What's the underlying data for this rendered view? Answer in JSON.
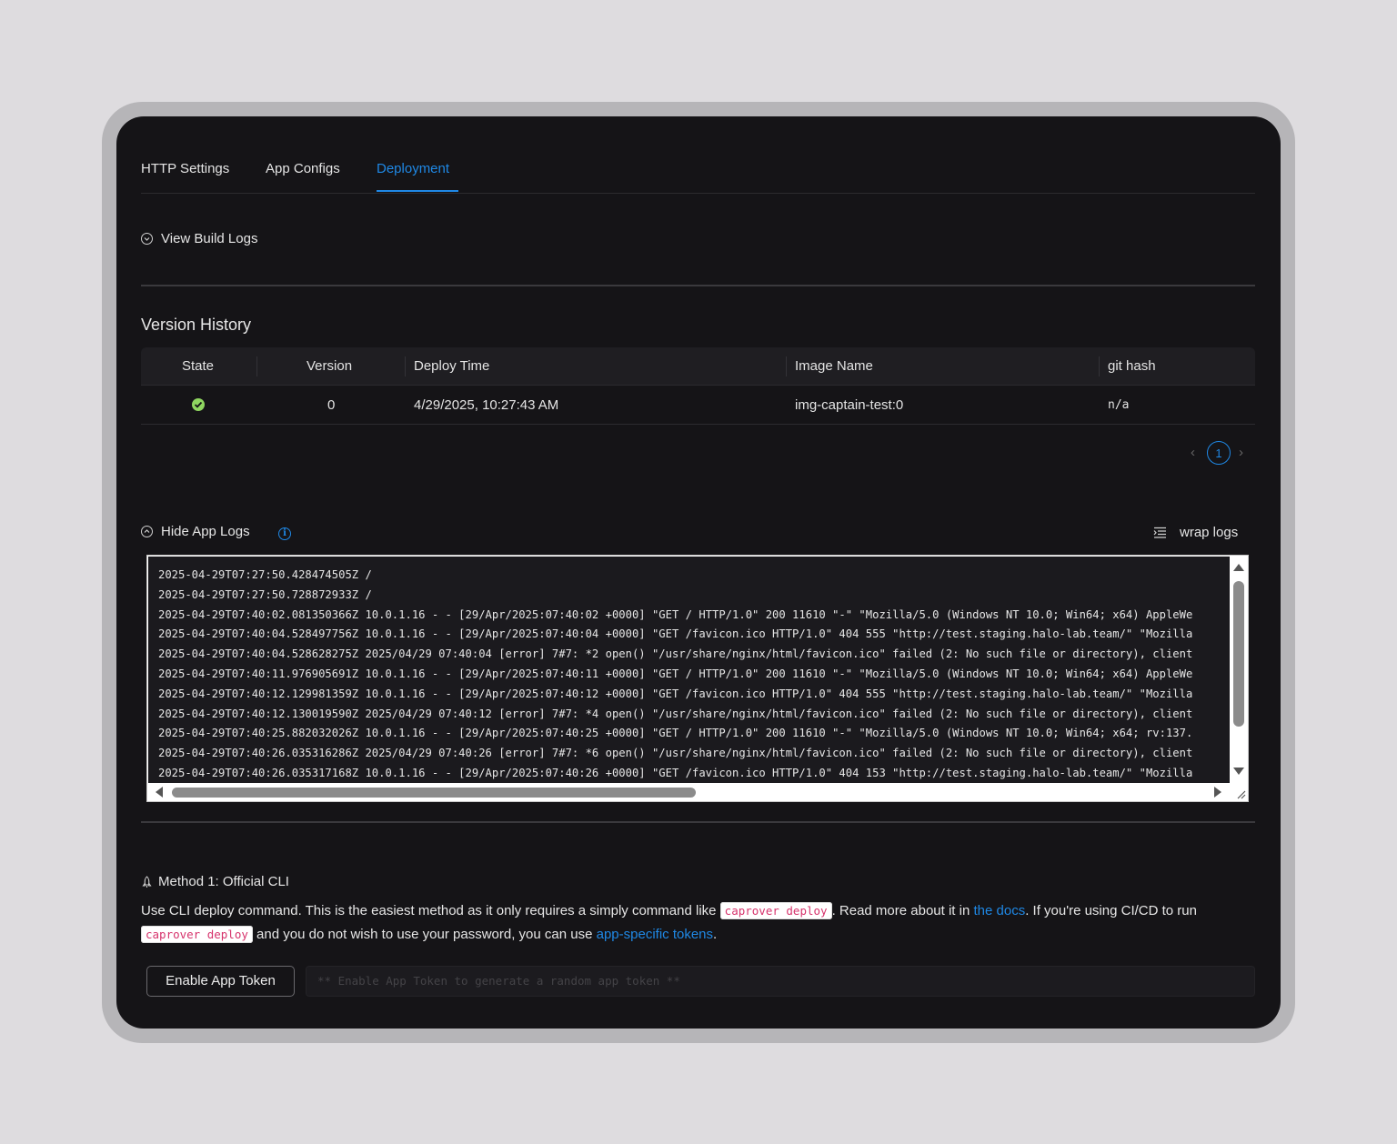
{
  "tabs": [
    {
      "label": "HTTP Settings"
    },
    {
      "label": "App Configs"
    },
    {
      "label": "Deployment"
    }
  ],
  "active_tab": "Deployment",
  "build_logs": {
    "label": "View Build Logs"
  },
  "version_history": {
    "title": "Version History",
    "columns": [
      "State",
      "Version",
      "Deploy Time",
      "Image Name",
      "git hash"
    ],
    "rows": [
      {
        "state": "success",
        "version": "0",
        "deploy_time": "4/29/2025, 10:27:43 AM",
        "image_name": "img-captain-test:0",
        "git_hash": "n/a"
      }
    ],
    "pagination": {
      "current_page": "1",
      "prev": "‹",
      "next": "›"
    }
  },
  "app_logs": {
    "toggle_label": "Hide App Logs",
    "wrap_label": "wrap logs",
    "lines": [
      "2025-04-29T07:27:50.428474505Z /",
      "2025-04-29T07:27:50.728872933Z /",
      "2025-04-29T07:40:02.081350366Z 10.0.1.16 - - [29/Apr/2025:07:40:02 +0000] \"GET / HTTP/1.0\" 200 11610 \"-\" \"Mozilla/5.0 (Windows NT 10.0; Win64; x64) AppleWe",
      "2025-04-29T07:40:04.528497756Z 10.0.1.16 - - [29/Apr/2025:07:40:04 +0000] \"GET /favicon.ico HTTP/1.0\" 404 555 \"http://test.staging.halo-lab.team/\" \"Mozilla",
      "2025-04-29T07:40:04.528628275Z 2025/04/29 07:40:04 [error] 7#7: *2 open() \"/usr/share/nginx/html/favicon.ico\" failed (2: No such file or directory), client",
      "2025-04-29T07:40:11.976905691Z 10.0.1.16 - - [29/Apr/2025:07:40:11 +0000] \"GET / HTTP/1.0\" 200 11610 \"-\" \"Mozilla/5.0 (Windows NT 10.0; Win64; x64) AppleWe",
      "2025-04-29T07:40:12.129981359Z 10.0.1.16 - - [29/Apr/2025:07:40:12 +0000] \"GET /favicon.ico HTTP/1.0\" 404 555 \"http://test.staging.halo-lab.team/\" \"Mozilla",
      "2025-04-29T07:40:12.130019590Z 2025/04/29 07:40:12 [error] 7#7: *4 open() \"/usr/share/nginx/html/favicon.ico\" failed (2: No such file or directory), client",
      "2025-04-29T07:40:25.882032026Z 10.0.1.16 - - [29/Apr/2025:07:40:25 +0000] \"GET / HTTP/1.0\" 200 11610 \"-\" \"Mozilla/5.0 (Windows NT 10.0; Win64; x64; rv:137.",
      "2025-04-29T07:40:26.035316286Z 2025/04/29 07:40:26 [error] 7#7: *6 open() \"/usr/share/nginx/html/favicon.ico\" failed (2: No such file or directory), client",
      "2025-04-29T07:40:26.035317168Z 10.0.1.16 - - [29/Apr/2025:07:40:26 +0000] \"GET /favicon.ico HTTP/1.0\" 404 153 \"http://test.staging.halo-lab.team/\" \"Mozilla"
    ]
  },
  "method": {
    "title": "Method 1: Official CLI",
    "text_1": "Use CLI deploy command. This is the easiest method as it only requires a simply command like ",
    "code_1": "caprover deploy",
    "text_2": ". Read more about it in ",
    "link_docs": "the docs",
    "text_3": ". If you're using CI/CD to run ",
    "code_2": "caprover deploy",
    "text_4": " and you do not wish to use your password, you can use ",
    "link_tokens": "app-specific tokens",
    "text_5": "."
  },
  "token": {
    "button_label": "Enable App Token",
    "placeholder": "** Enable App Token to generate a random app token **"
  },
  "colors": {
    "accent": "#1f88e5",
    "success": "#8fd660",
    "code": "#d6336c",
    "background": "#151417"
  }
}
